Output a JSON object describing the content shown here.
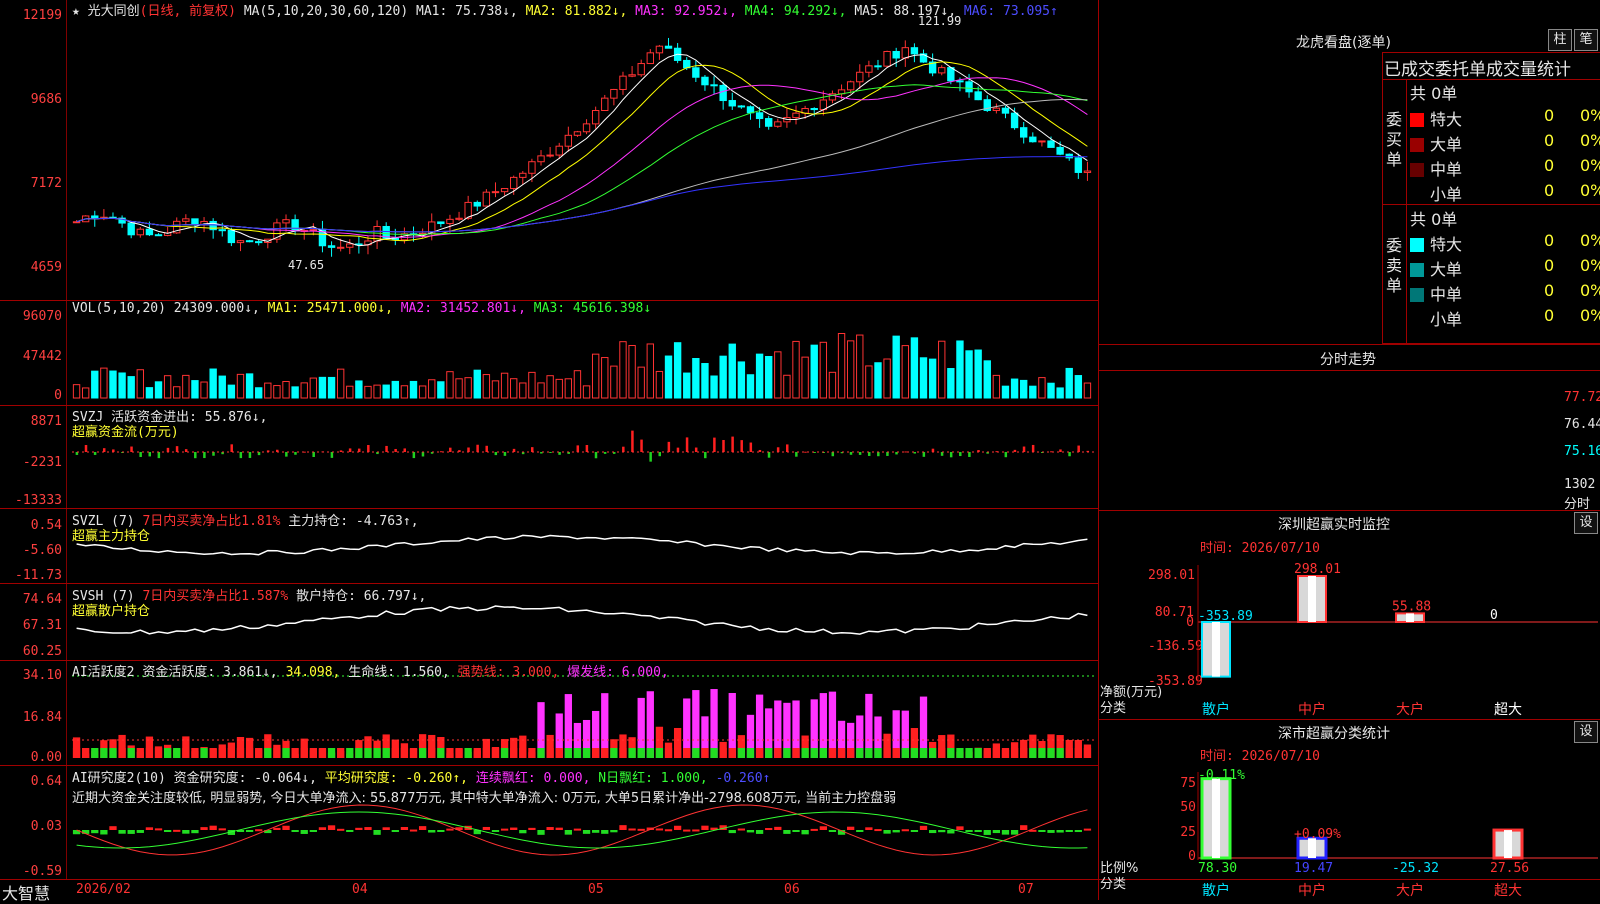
{
  "colors": {
    "up": "#ff3333",
    "down": "#00ffff",
    "panel_border": "#a00000"
  },
  "kline": {
    "star": "★",
    "name": "光大同创",
    "mode": "(日线, 前复权)",
    "ma_label": "MA(5,10,20,30,60,120)",
    "ma1": "MA1: 75.738↓,",
    "ma2": "MA2: 81.882↓,",
    "ma3": "MA3: 92.952↓,",
    "ma4": "MA4: 94.292↓,",
    "ma5": "MA5: 88.197↓,",
    "ma6": "MA6: 73.095↑",
    "y_ticks": [
      "12199",
      "9686",
      "7172",
      "4659"
    ],
    "high_label": "121.99",
    "low_label": "47.65"
  },
  "vol": {
    "label": "VOL(5,10,20)",
    "value": "24309.000↓,",
    "ma1": "MA1: 25471.000↓,",
    "ma2": "MA2: 31452.801↓,",
    "ma3": "MA3: 45616.398↓",
    "y_ticks": [
      "96070",
      "47442",
      "0"
    ]
  },
  "svzj": {
    "label": "SVZJ",
    "desc": "活跃资金进出: 55.876↓,",
    "sub": "超赢资金流(万元)",
    "y_ticks": [
      "8871",
      "-2231",
      "-13333"
    ]
  },
  "svzl": {
    "label": "SVZL (7)",
    "ratio": "7日内买卖净占比1.81%",
    "main": "主力持仓: -4.763↑,",
    "sub": "超赢主力持仓",
    "y_ticks": [
      "0.54",
      "-5.60",
      "-11.73"
    ]
  },
  "svsh": {
    "label": "SVSH (7)",
    "ratio": "7日内买卖净占比1.587%",
    "retail": "散户持仓: 66.797↓,",
    "sub": "超赢散户持仓",
    "y_ticks": [
      "74.64",
      "67.31",
      "60.25"
    ]
  },
  "ai1": {
    "label": "AI活跃度2",
    "v1": "资金活跃度: 3.861↓,",
    "v2": "34.098,",
    "v3": "生命线: 1.560,",
    "v4": "强势线: 3.000,",
    "v5": "爆发线: 6.000,",
    "y_ticks": [
      "34.10",
      "16.84",
      "0.00"
    ]
  },
  "ai2": {
    "label": "AI研究度2(10)",
    "v1": "资金研究度: -0.064↓,",
    "v2": "平均研究度: -0.260↑,",
    "v3": "连续飘红: 0.000,",
    "v4": "N日飘红: 1.000,",
    "v5": "-0.260↑",
    "comment": "近期大资金关注度较低, 明显弱势, 今日大单净流入: 55.877万元, 其中特大单净流入: 0万元, 大单5日累计净出-2798.608万元, 当前主力控盘弱",
    "y_ticks": [
      "0.64",
      "0.03",
      "-0.59"
    ]
  },
  "xaxis": {
    "brand": "大智慧",
    "labels": [
      "2026/02",
      "04",
      "05",
      "06",
      "07"
    ]
  },
  "lhb": {
    "title": "龙虎看盘(逐单)",
    "btn1": "柱",
    "btn2": "笔",
    "header": "已成交委托单成交量统计",
    "buy_side": "委买单",
    "sell_side": "委卖单",
    "buy_total": "共 0单",
    "sell_total": "共 0单",
    "buy_rows": [
      {
        "name": "特大",
        "n": "0",
        "p": "0%",
        "c": "#ff0000"
      },
      {
        "name": "大单",
        "n": "0",
        "p": "0%",
        "c": "#990000"
      },
      {
        "name": "中单",
        "n": "0",
        "p": "0%",
        "c": "#660000"
      },
      {
        "name": "小单",
        "n": "0",
        "p": "0%",
        "c": "#000000"
      }
    ],
    "sell_rows": [
      {
        "name": "特大",
        "n": "0",
        "p": "0%",
        "c": "#00ffff"
      },
      {
        "name": "大单",
        "n": "0",
        "p": "0%",
        "c": "#009999"
      },
      {
        "name": "中单",
        "n": "0",
        "p": "0%",
        "c": "#007777"
      },
      {
        "name": "小单",
        "n": "0",
        "p": "0%",
        "c": "#000000"
      }
    ]
  },
  "intraday": {
    "title": "分时走势",
    "y_ticks": [
      "77.72",
      "76.44",
      "75.16"
    ],
    "vol_tick": "1302",
    "unit": "分时"
  },
  "monitor": {
    "title": "深圳超赢实时监控",
    "btn": "设",
    "time": "时间: 2026/07/10",
    "y_ticks": [
      "298.01",
      "80.71",
      "0",
      "-136.59",
      "-353.89"
    ],
    "y_label": "净额(万元)",
    "x_label": "分类",
    "categories": [
      "散户",
      "中户",
      "大户",
      "超大"
    ],
    "chart_data": {
      "type": "bar",
      "categories": [
        "散户",
        "中户",
        "大户",
        "超大"
      ],
      "values": [
        -353.89,
        298.01,
        55.88,
        0
      ],
      "ylabel": "净额(万元)",
      "ylim": [
        -353.89,
        298.01
      ]
    },
    "value_labels": [
      "-353.89",
      "298.01",
      "55.88",
      "0"
    ]
  },
  "classify": {
    "title": "深市超赢分类统计",
    "btn": "设",
    "time": "时间: 2026/07/10",
    "y_ticks": [
      "75",
      "50",
      "25",
      "0"
    ],
    "y_label": "比例%",
    "x_label": "分类",
    "categories": [
      "散户",
      "中户",
      "大户",
      "超大"
    ],
    "chart_data": {
      "type": "bar",
      "categories": [
        "散户",
        "中户",
        "大户",
        "超大"
      ],
      "values": [
        78.3,
        19.47,
        -25.32,
        27.56
      ],
      "ylabel": "比例%"
    },
    "bottom_labels": [
      "78.30",
      "19.47",
      "-25.32",
      "27.56"
    ],
    "top_labels": [
      "-0.11%",
      "+0.09%"
    ]
  }
}
